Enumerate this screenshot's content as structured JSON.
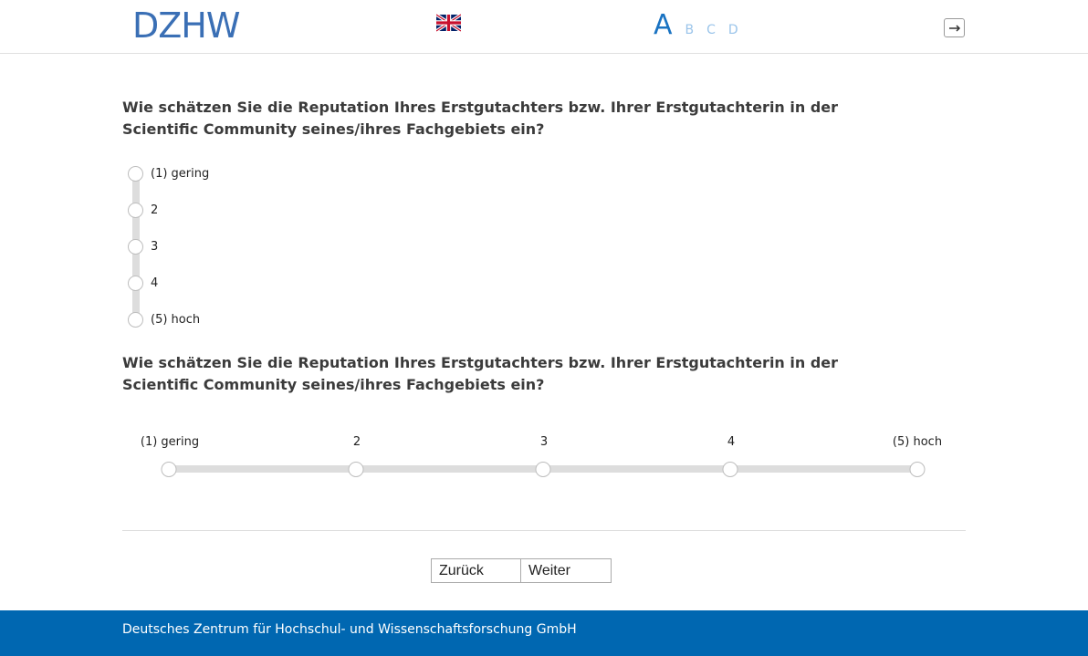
{
  "header": {
    "logo_text": "DZHW",
    "language_flag_icon": "uk-flag-icon",
    "font_sizes": [
      "A",
      "B",
      "C",
      "D"
    ],
    "logout_icon": "logout-icon"
  },
  "questions": [
    {
      "text": "Wie schätzen Sie die Reputation Ihres Erstgutachters bzw. Ihrer Erstgutachterin in der Scientific Community seines/ihres Fachgebiets ein?",
      "layout": "vertical",
      "options": [
        "(1) gering",
        "2",
        "3",
        "4",
        "(5) hoch"
      ]
    },
    {
      "text": "Wie schätzen Sie die Reputation Ihres Erstgutachters bzw. Ihrer Erstgutachterin in der Scientific Community seines/ihres Fachgebiets ein?",
      "layout": "horizontal",
      "options": [
        "(1) gering",
        "2",
        "3",
        "4",
        "(5) hoch"
      ]
    }
  ],
  "navigation": {
    "back_label": "Zurück",
    "next_label": "Weiter"
  },
  "footer": {
    "text": "Deutsches Zentrum für Hochschul- und Wissenschaftsforschung GmbH"
  },
  "colors": {
    "accent": "#1a73c2",
    "footer_bg": "#0067b1",
    "track": "#dddddd"
  }
}
